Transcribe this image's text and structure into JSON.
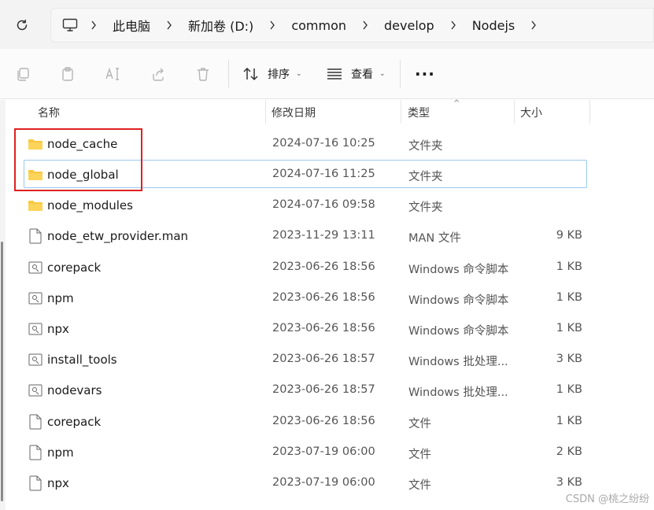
{
  "breadcrumb": {
    "items": [
      {
        "label": "此电脑"
      },
      {
        "label": "新加卷 (D:)"
      },
      {
        "label": "common"
      },
      {
        "label": "develop"
      },
      {
        "label": "Nodejs"
      }
    ]
  },
  "toolbar": {
    "sort_label": "排序",
    "view_label": "查看",
    "more_label": "···"
  },
  "columns": {
    "name": "名称",
    "date": "修改日期",
    "type": "类型",
    "size": "大小"
  },
  "files": [
    {
      "name": "node_cache",
      "date": "2024-07-16 10:25",
      "type": "文件夹",
      "size": "",
      "icon": "folder-icon"
    },
    {
      "name": "node_global",
      "date": "2024-07-16 11:25",
      "type": "文件夹",
      "size": "",
      "icon": "folder-icon",
      "selected": true
    },
    {
      "name": "node_modules",
      "date": "2024-07-16 09:58",
      "type": "文件夹",
      "size": "",
      "icon": "folder-icon"
    },
    {
      "name": "node_etw_provider.man",
      "date": "2023-11-29 13:11",
      "type": "MAN 文件",
      "size": "9 KB",
      "icon": "file-icon"
    },
    {
      "name": "corepack",
      "date": "2023-06-26 18:56",
      "type": "Windows 命令脚本",
      "size": "1 KB",
      "icon": "script-icon"
    },
    {
      "name": "npm",
      "date": "2023-06-26 18:56",
      "type": "Windows 命令脚本",
      "size": "1 KB",
      "icon": "script-icon"
    },
    {
      "name": "npx",
      "date": "2023-06-26 18:56",
      "type": "Windows 命令脚本",
      "size": "1 KB",
      "icon": "script-icon"
    },
    {
      "name": "install_tools",
      "date": "2023-06-26 18:57",
      "type": "Windows 批处理...",
      "size": "3 KB",
      "icon": "script-icon"
    },
    {
      "name": "nodevars",
      "date": "2023-06-26 18:57",
      "type": "Windows 批处理...",
      "size": "1 KB",
      "icon": "script-icon"
    },
    {
      "name": "corepack",
      "date": "2023-06-26 18:56",
      "type": "文件",
      "size": "1 KB",
      "icon": "file-icon"
    },
    {
      "name": "npm",
      "date": "2023-07-19 06:00",
      "type": "文件",
      "size": "2 KB",
      "icon": "file-icon"
    },
    {
      "name": "npx",
      "date": "2023-07-19 06:00",
      "type": "文件",
      "size": "3 KB",
      "icon": "file-icon"
    }
  ],
  "watermark": "CSDN @桃之纷纷",
  "colors": {
    "highlight_red": "#e02020",
    "selection_border": "#99c9ef",
    "folder_yellow": "#f8c840"
  }
}
